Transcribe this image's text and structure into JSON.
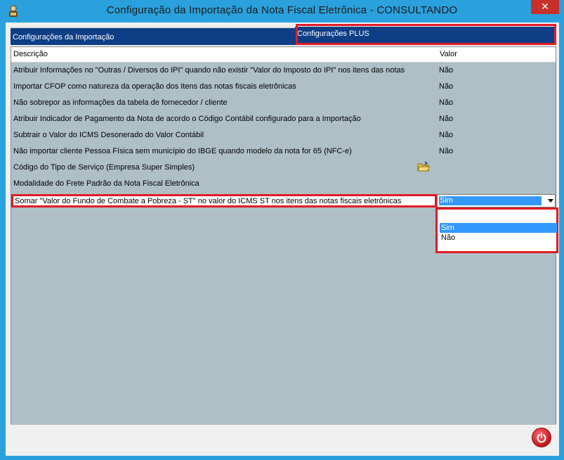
{
  "window": {
    "title": "Configuração da Importação da Nota Fiscal Eletrônica   -   CONSULTANDO",
    "close_label": "✕"
  },
  "tabs": [
    {
      "label": "Configurações da Importação"
    },
    {
      "label": "Configurações PLUS"
    }
  ],
  "grid": {
    "columns": {
      "description": "Descrição",
      "value": "Valor"
    },
    "rows": [
      {
        "description": "Atribuir Informações no \"Outras / Diversos do IPI\" quando não existir \"Valor do Imposto do IPI\" nos itens das notas",
        "value": "Não"
      },
      {
        "description": "Importar CFOP como natureza da operação dos Itens das notas fiscais eletrônicas",
        "value": "Não"
      },
      {
        "description": "Não sobrepor as informações da tabela de fornecedor / cliente",
        "value": "Não"
      },
      {
        "description": "Atribuir Indicador de Pagamento da Nota de acordo o Código Contábil configurado para a Importação",
        "value": "Não"
      },
      {
        "description": "Subtrair o Valor do ICMS Desonerado do Valor Contábil",
        "value": "Não"
      },
      {
        "description": "Não importar cliente Pessoa Física sem município do IBGE quando modelo da nota for 65 (NFC-e)",
        "value": "Não"
      },
      {
        "description": "Código do Tipo de Serviço (Empresa Super Simples)",
        "value": ""
      },
      {
        "description": "Modalidade do Frete Padrão da Nota Fiscal Eletrônica",
        "value": ""
      }
    ],
    "editing_row": {
      "description": "Somar \"Valor do Fundo de Combate a Pobreza - ST\" no valor do ICMS ST nos itens das notas fiscais eletrônicas",
      "value": "Sim",
      "options": [
        "Sim",
        "Não"
      ],
      "selected_option": "Sim"
    }
  },
  "icons": {
    "folder": "folder-open-icon",
    "power": "power-icon",
    "app": "app-user-icon"
  },
  "colors": {
    "titlebar": "#2aa1dd",
    "tab_bg": "#0d3e86",
    "grid_bg": "#aebfc6",
    "highlight": "#e21b26",
    "selection": "#3399ff"
  }
}
